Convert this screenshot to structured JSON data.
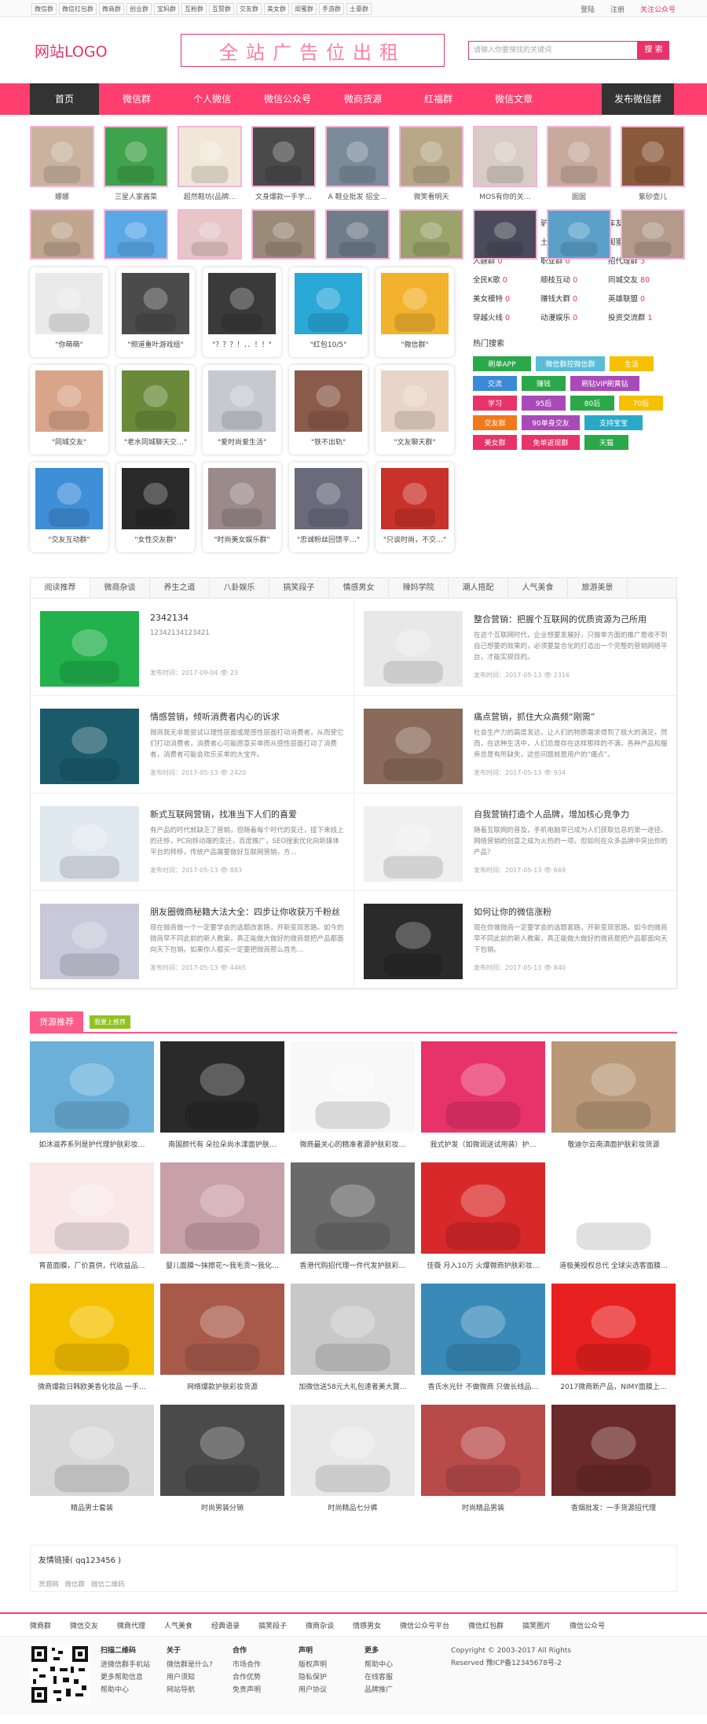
{
  "topbar": {
    "tags": [
      "微信群",
      "微信红包群",
      "微商群",
      "创业群",
      "宝妈群",
      "互粉群",
      "互赞群",
      "交友群",
      "美女群",
      "闺蜜群",
      "手游群",
      "土豪群"
    ],
    "login": "登陆",
    "register": "注册",
    "follow": "关注公众号"
  },
  "header": {
    "logo": "网站LOGO",
    "ad": "全站广告位出租",
    "search_placeholder": "请输入你要搜找的关键词",
    "search_btn": "搜 索"
  },
  "nav": {
    "home": "首页",
    "items": [
      "微信群",
      "个人微信",
      "微信公众号",
      "微商货源",
      "红福群",
      "微信文章"
    ],
    "publish": "发布微信群"
  },
  "avatars": [
    {
      "cap": "娜娜",
      "c": "#c9b39e"
    },
    {
      "cap": "三星人家酱菜",
      "c": "#3fa24c"
    },
    {
      "cap": "超然鞋坊(品牌…",
      "c": "#f0e7d8"
    },
    {
      "cap": "文身爆款一手学…",
      "c": "#4a4a4a"
    },
    {
      "cap": "A 鞋业批发 招全…",
      "c": "#7b8b9a"
    },
    {
      "cap": "微笑看明天",
      "c": "#b8a888"
    },
    {
      "cap": "MOS有你的关…",
      "c": "#d8ccc4"
    },
    {
      "cap": "囡囡",
      "c": "#c7aa9c"
    },
    {
      "cap": "紫砂壶儿",
      "c": "#8b5a3c"
    }
  ],
  "avatars2": [
    {
      "c": "#c0a68e"
    },
    {
      "c": "#5aa9e6"
    },
    {
      "c": "#e6c6c6"
    },
    {
      "c": "#9a8a78"
    },
    {
      "c": "#6f7c8a"
    },
    {
      "c": "#9aa36a"
    },
    {
      "c": "#4a4a5a"
    },
    {
      "c": "#5aa0c8"
    },
    {
      "c": "#b39a8a"
    }
  ],
  "cards": [
    {
      "cap": "\"你萌萌\"",
      "c": "#eaeaea"
    },
    {
      "cap": "\"频道重叶游戏组\"",
      "c": "#4b4b4b"
    },
    {
      "cap": "\"？？？！．．！！\"",
      "c": "#3a3a3a"
    },
    {
      "cap": "\"红包10/5\"",
      "c": "#2aa8d8"
    },
    {
      "cap": "\"微信群\"",
      "c": "#f2b22e"
    },
    {
      "cap": "\"同城交友\"",
      "c": "#d8a48a"
    },
    {
      "cap": "\"老水同城聊天交…\"",
      "c": "#6a8a3a"
    },
    {
      "cap": "\"爱时尚爱生活\"",
      "c": "#c8c8d0"
    },
    {
      "cap": "\"铁不出轨\"",
      "c": "#8a5a4a"
    },
    {
      "cap": "\"文友聊天群\"",
      "c": "#e8d4c8"
    },
    {
      "cap": "\"交友互动群\"",
      "c": "#3f8ed8"
    },
    {
      "cap": "\"女性交友群\"",
      "c": "#2a2a2a"
    },
    {
      "cap": "\"时尚美女娱乐群\"",
      "c": "#9a8a8a"
    },
    {
      "cap": "\"忠诚粉丝回馈平…\"",
      "c": "#6a6a7a"
    },
    {
      "cap": "\"只谈时尚，不交…\"",
      "c": "#c8322a"
    }
  ],
  "groups": [
    [
      "互赞群",
      "40"
    ],
    [
      "驴友群",
      "0"
    ],
    [
      "车友群",
      "0"
    ],
    [
      "摄影群",
      "0"
    ],
    [
      "土豪群",
      "1"
    ],
    [
      "闺蜜群",
      "1"
    ],
    [
      "人脉群",
      "0"
    ],
    [
      "职业群",
      "0"
    ],
    [
      "招代理群",
      "3"
    ],
    [
      "全民K歌",
      "0"
    ],
    [
      "顺枝互动",
      "0"
    ],
    [
      "同城交友",
      "80"
    ],
    [
      "美女模特",
      "0"
    ],
    [
      "赚钱大群",
      "0"
    ],
    [
      "英雄联盟",
      "0"
    ],
    [
      "穿越火线",
      "0"
    ],
    [
      "动漫娱乐",
      "0"
    ],
    [
      "投资交流群",
      "1"
    ]
  ],
  "hot_title": "热门搜索",
  "tags": [
    {
      "t": "刷单APP",
      "c": "#2aa84a",
      "w": 74
    },
    {
      "t": "微信群控微信群",
      "c": "#5bbcd8",
      "w": 88
    },
    {
      "t": "生活",
      "c": "#f5c000",
      "w": 56
    },
    {
      "t": "交流",
      "c": "#3a8ad8",
      "w": 56
    },
    {
      "t": "赚钱",
      "c": "#2aa84a",
      "w": 56
    },
    {
      "t": "刷钻VIP刷黄钻",
      "c": "#a84ab8",
      "w": 88
    },
    {
      "t": "学习",
      "c": "#e8336a",
      "w": 56
    },
    {
      "t": "95后",
      "c": "#a84ab8",
      "w": 56
    },
    {
      "t": "80后",
      "c": "#2aa84a",
      "w": 56
    },
    {
      "t": "70后",
      "c": "#f5c000",
      "w": 56
    },
    {
      "t": "交友群",
      "c": "#f07a1a",
      "w": 56
    },
    {
      "t": "90单身交友",
      "c": "#a84ab8",
      "w": 74
    },
    {
      "t": "支持宝宝",
      "c": "#2aa8c8",
      "w": 74
    },
    {
      "t": "美女群",
      "c": "#e8336a",
      "w": 56
    },
    {
      "t": "免单返现群",
      "c": "#e8336a",
      "w": 74
    },
    {
      "t": "天猫",
      "c": "#2aa84a",
      "w": 56
    }
  ],
  "art_tabs": [
    "阅读推荐",
    "微商杂谈",
    "养生之道",
    "八卦娱乐",
    "搞笑段子",
    "情感男女",
    "辣妈学院",
    "潮人搭配",
    "人气美食",
    "旅游美景"
  ],
  "articles": [
    {
      "t": "2342134",
      "d": "12342134123421",
      "m": "发布时间：2017-09-04  👁 23",
      "c": "#22b14c"
    },
    {
      "t": "整合营销：把握个互联网的优质资源为己所用",
      "d": "在这个互联网时代，企业想要发展好，只做单方面的推广是收不到自己想要的效果的，必须要复合化的打造出一个完整的营销网络平台，才能实现目的。",
      "m": "发布时间：2017-05-13  👁 2316",
      "c": "#e8e8e8"
    },
    {
      "t": "情感营销，倾听消费者内心的诉求",
      "d": "微商我无非是尝试以理性层面或是感性层面打动消费者，从而使它们打动消费者，消费者心可能愿意买单而从感性层面打动了消费者，消费者可能会欢乐买单的大宝件。",
      "m": "发布时间：2017-05-13  👁 2420",
      "c": "#1a5a6a"
    },
    {
      "t": "痛点营销，抓住大众高频“刚需”",
      "d": "社会生产力的高度发达，让人们的物质需求得到了极大的满足。然而，在这种生活中，人们总是存在这样那样的不满，各种产品和服务总是有所缺失，这些问题就是用户的“痛点”。",
      "m": "发布时间：2017-05-13  👁 934",
      "c": "#8a6a5a"
    },
    {
      "t": "新式互联网营销，找准当下人们的喜爱",
      "d": "有产品的时代就缺乏了营销，但随着每个时代的变迁，接下来线上的迁移，PC向移动端的变迁，百度推广，SEO搜索优化向新媒体平台的转移，传统产品需要做好互联网营销，方…",
      "m": "发布时间：2017-05-13  👁 883",
      "c": "#e0e8f0"
    },
    {
      "t": "自我营销打造个人品牌，增加核心竞争力",
      "d": "随着互联网的普及，手机电脑早已成为人们获取信息的第一途径。网络营销的创意之成为火热的一项，但如何在众多品牌中突出你的产品？",
      "m": "发布时间：2017-05-13  👁 669",
      "c": "#f0f0f0"
    },
    {
      "t": "朋友圈微商秘籍大法大全：四步让你收获万千粉丝",
      "d": "现在微商做一个一定要学会的选题改套路，开新变现思路。如今的微商早不同此前的新人教案，真正能做大做好的微商是把产品都面向天下包销。如果你人都买一定要把微商那么首先…",
      "m": "发布时间：2017-05-13  👁 4465",
      "c": "#c8c8d8"
    },
    {
      "t": "如何让你的微信涨粉",
      "d": "现在你做微商一定要学会的选题套路，开新变现思路。如今的微商早不同此前的新人教案，真正能做大做好的微商是把产品都面向天下包销。",
      "m": "发布时间：2017-05-13  👁 840",
      "c": "#2a2a2a"
    }
  ],
  "goods_title": "货源推荐",
  "goods_badge": "我要上推荐",
  "goods": [
    {
      "cap": "如沐滋养系列是护代理护肤彩妆…",
      "c": "#6ab0d8"
    },
    {
      "cap": "南国颜代有 朵拉朵尚水漾面护肤…",
      "c": "#2a2a2a"
    },
    {
      "cap": "微商最关心的精准者源护肤彩妆…",
      "c": "#f8f8f8"
    },
    {
      "cap": "我式护发（如微润送试用装）护…",
      "c": "#e8336a"
    },
    {
      "cap": "敬迪尔云南滇面护肤彩妆货源",
      "c": "#b89878"
    },
    {
      "cap": "育苗面膜，厂价直供，代收益品…",
      "c": "#f8e8e8"
    },
    {
      "cap": "婴儿面膜～抹擦花～我毛贡～我化…",
      "c": "#c8a0a8"
    },
    {
      "cap": "香港代购招代理一件代发护肤彩…",
      "c": "#6a6a6a"
    },
    {
      "cap": "佳薇 月入10万 火爆微商护肤彩妆…",
      "c": "#d8282a"
    },
    {
      "cap": "道极美授权总代 全球尖选客面膜…",
      "c": "#ffffff"
    },
    {
      "cap": "微商爆款日韩欧美香化妆品 一手…",
      "c": "#f5c000"
    },
    {
      "cap": "网络爆款护肤彩妆货源",
      "c": "#a85a4a"
    },
    {
      "cap": "加微信送58元大礼包速者美大寳…",
      "c": "#c8c8c8"
    },
    {
      "cap": "香氏水光针 不做微商 只做长线品…",
      "c": "#3a8ab8"
    },
    {
      "cap": "2017微商新产品，NIMY面膜上…",
      "c": "#e82020"
    },
    {
      "cap": "精品男士套装",
      "c": "#d8d8d8"
    },
    {
      "cap": "时尚男装分销",
      "c": "#4a4a4a"
    },
    {
      "cap": "时尚精品七分裤",
      "c": "#e8e8e8"
    },
    {
      "cap": "时尚精品男装",
      "c": "#b84a4a"
    },
    {
      "cap": "香烟批发：一手货源招代理",
      "c": "#6a2a2a"
    }
  ],
  "links": {
    "title": "友情链接( qq123456 )",
    "items": [
      "货源网",
      "微信群",
      "微信二维码"
    ]
  },
  "fnav": [
    "微商群",
    "微信交友",
    "微商代理",
    "人气美食",
    "经典语录",
    "搞笑段子",
    "微商杂谈",
    "情感男女",
    "微信公众号平台",
    "微信红包群",
    "搞笑图片",
    "微信公众号"
  ],
  "footer": {
    "cols": [
      {
        "h": "扫描二维码",
        "items": [
          "进微信群手机站",
          "更多帮助信息",
          "帮助中心"
        ]
      },
      {
        "h": "关于",
        "items": [
          "微信群是什么?",
          "用户须知",
          "网站导航"
        ]
      },
      {
        "h": "合作",
        "items": [
          "市场合作",
          "合作优势",
          "免责声明"
        ]
      },
      {
        "h": "声明",
        "items": [
          "版权声明",
          "隐私保护",
          "用户协议"
        ]
      },
      {
        "h": "更多",
        "items": [
          "帮助中心",
          "在线客服",
          "品牌推广"
        ]
      }
    ],
    "copy1": "Copyright © 2003-2017 All Rights",
    "copy2": "Reserved  豫ICP备12345678号-2"
  }
}
